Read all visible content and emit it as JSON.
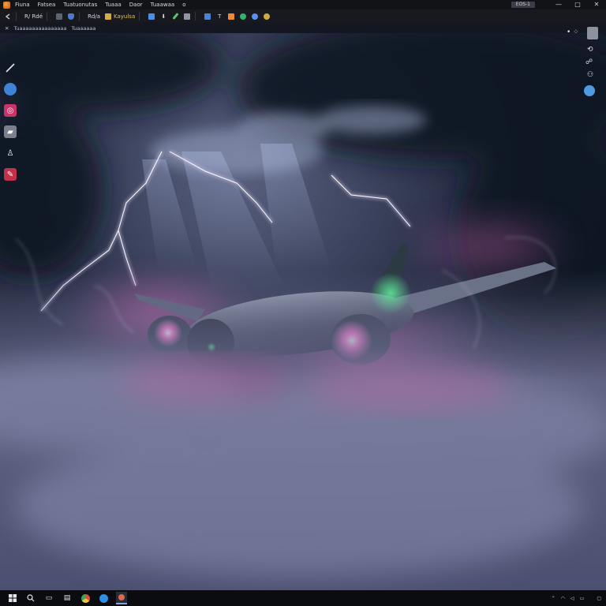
{
  "menu": {
    "items": [
      "Fiuna",
      "Fatsea",
      "Tuatuonutas",
      "Tuaaa",
      "Daor",
      "Tuaawaa",
      "o"
    ]
  },
  "window": {
    "badge": "EOS-1",
    "minimize": "—",
    "maximize": "□",
    "close": "✕"
  },
  "toolbar": {
    "label_a": "R/ Rdé",
    "label_b": "Rd/a",
    "label_c": "Kayulsa"
  },
  "substrip": {
    "left": "Tuaaaaaaaaaaaaaaa",
    "right": "Tuaaaaaa"
  },
  "icons": {
    "toolbox": [
      "pen-icon",
      "globe-icon",
      "circle-brush-icon",
      "eraser-icon",
      "figure-icon",
      "pin-icon"
    ],
    "gizmo": [
      "orbit-icon",
      "axis-icon",
      "hand-icon",
      "camera-icon",
      "sphere-icon"
    ],
    "taskbar": [
      "windows-icon",
      "search-icon",
      "task-view-icon",
      "explorer-icon",
      "chrome-icon",
      "edge-icon",
      "app-icon"
    ]
  },
  "colors": {
    "accent": "#7aa6e6",
    "lightning": "#d9c8ff",
    "fog_magenta": "#c55aa6",
    "sky": "#1b2030"
  }
}
